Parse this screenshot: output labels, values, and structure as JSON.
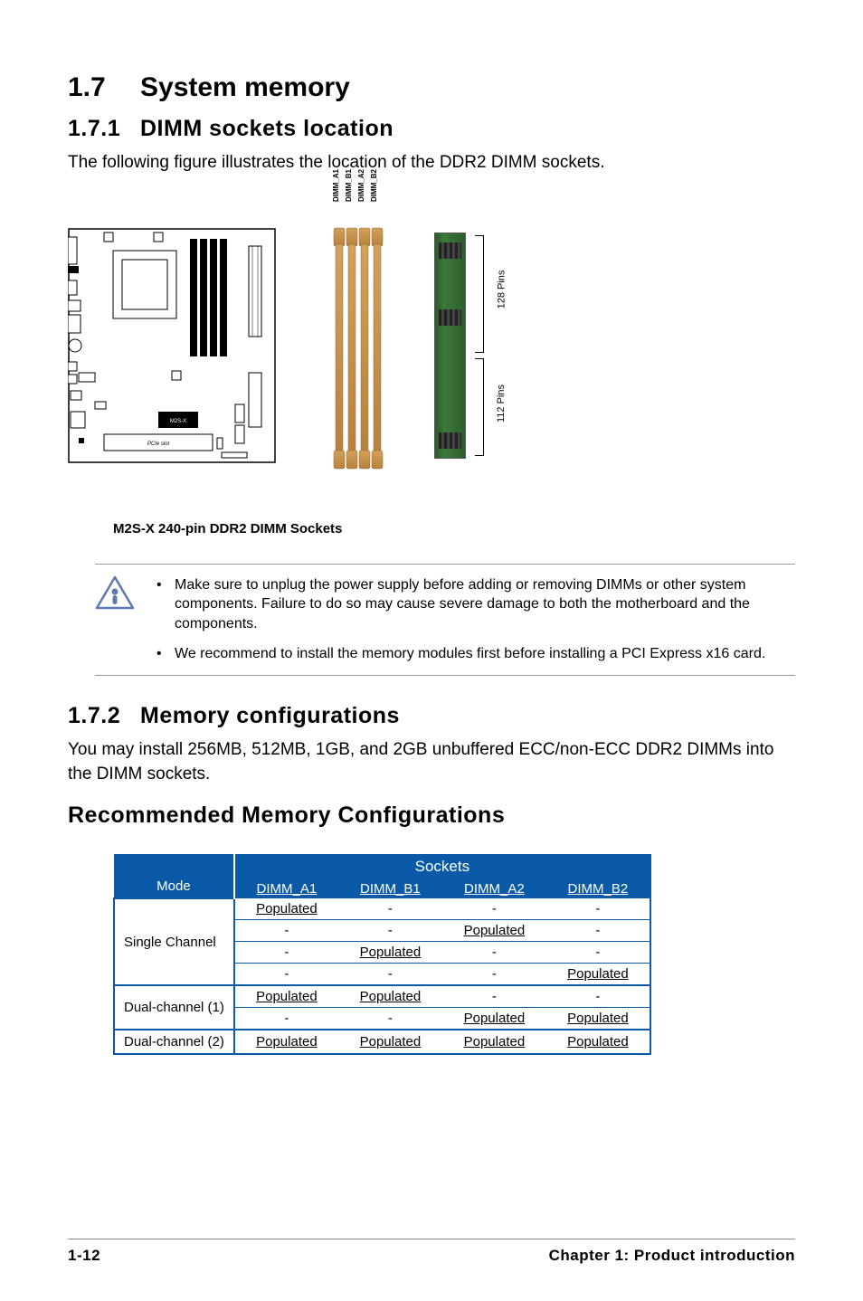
{
  "section": {
    "number": "1.7",
    "title": "System memory"
  },
  "sub1": {
    "number": "1.7.1",
    "title": "DIMM sockets location",
    "intro": "The following figure illustrates the location of the DDR2 DIMM sockets."
  },
  "figure": {
    "board_label": "M2S-X",
    "dimm_labels": [
      "DIMM_A1",
      "DIMM_B1",
      "DIMM_A2",
      "DIMM_B2"
    ],
    "bracket_top": "128 Pins",
    "bracket_bottom": "112 Pins",
    "caption": "M2S-X 240-pin DDR2 DIMM Sockets"
  },
  "note": {
    "items": [
      "Make sure to unplug the power supply before adding or removing DIMMs or other system components. Failure to do so may cause severe damage to both the motherboard and the components.",
      "We recommend to install the memory modules first before installing a PCI Express x16 card."
    ]
  },
  "sub2": {
    "number": "1.7.2",
    "title": "Memory configurations",
    "intro": "You may install 256MB, 512MB, 1GB, and 2GB unbuffered ECC/non-ECC DDR2 DIMMs into the DIMM sockets."
  },
  "recommended_title": "Recommended Memory Configurations",
  "table": {
    "sockets_header": "Sockets",
    "mode_header": "Mode",
    "columns": [
      "DIMM_A1",
      "DIMM_B1",
      "DIMM_A2",
      "DIMM_B2"
    ],
    "groups": [
      {
        "mode": "Single Channel",
        "rows": [
          [
            "Populated",
            "-",
            "-",
            "-"
          ],
          [
            "-",
            "-",
            "Populated",
            "-"
          ],
          [
            "-",
            "Populated",
            "-",
            "-"
          ],
          [
            "-",
            "-",
            "-",
            "Populated"
          ]
        ]
      },
      {
        "mode": "Dual-channel (1)",
        "rows": [
          [
            "Populated",
            "Populated",
            "-",
            "-"
          ],
          [
            "-",
            "-",
            "Populated",
            "Populated"
          ]
        ]
      },
      {
        "mode": "Dual-channel (2)",
        "rows": [
          [
            "Populated",
            "Populated",
            "Populated",
            "Populated"
          ]
        ]
      }
    ]
  },
  "footer": {
    "page": "1-12",
    "chapter": "Chapter 1: Product introduction"
  }
}
